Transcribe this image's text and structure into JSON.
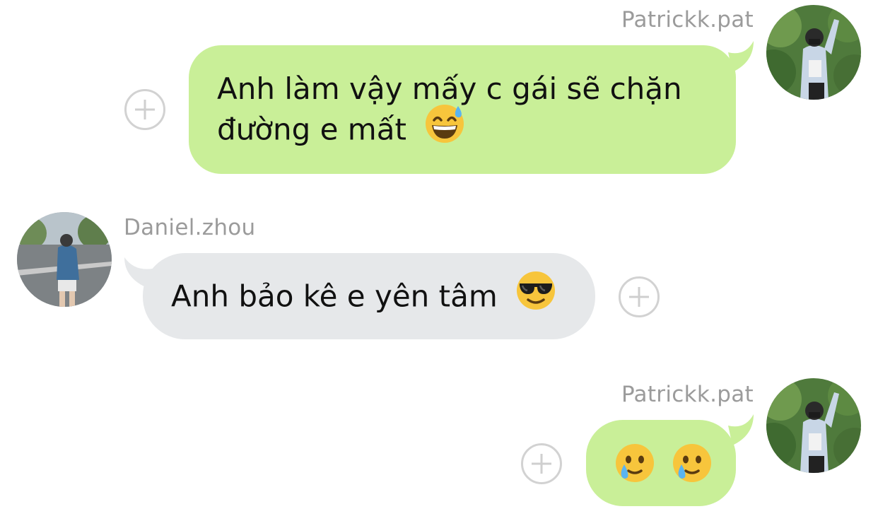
{
  "messages": [
    {
      "sender": "Patrickk.pat",
      "direction": "outgoing",
      "lines": [
        "Anh làm vậy mấy c gái sẽ chặn",
        "đường e mất"
      ],
      "emoji": [
        "grinning-face-with-sweat"
      ]
    },
    {
      "sender": "Daniel.zhou",
      "direction": "incoming",
      "lines": [
        "Anh bảo kê e yên tâm"
      ],
      "emoji": [
        "smiling-face-with-sunglasses"
      ]
    },
    {
      "sender": "Patrickk.pat",
      "direction": "outgoing",
      "lines": [],
      "emoji": [
        "face-holding-back-tears",
        "face-holding-back-tears"
      ]
    }
  ],
  "colors": {
    "outgoing_bubble": "#c9ef98",
    "incoming_bubble": "#e6e8ea",
    "sender_name": "#9b9b9b",
    "react_button": "#d2d2d2"
  },
  "icons": {
    "add_reaction": "plus-circle-icon"
  }
}
